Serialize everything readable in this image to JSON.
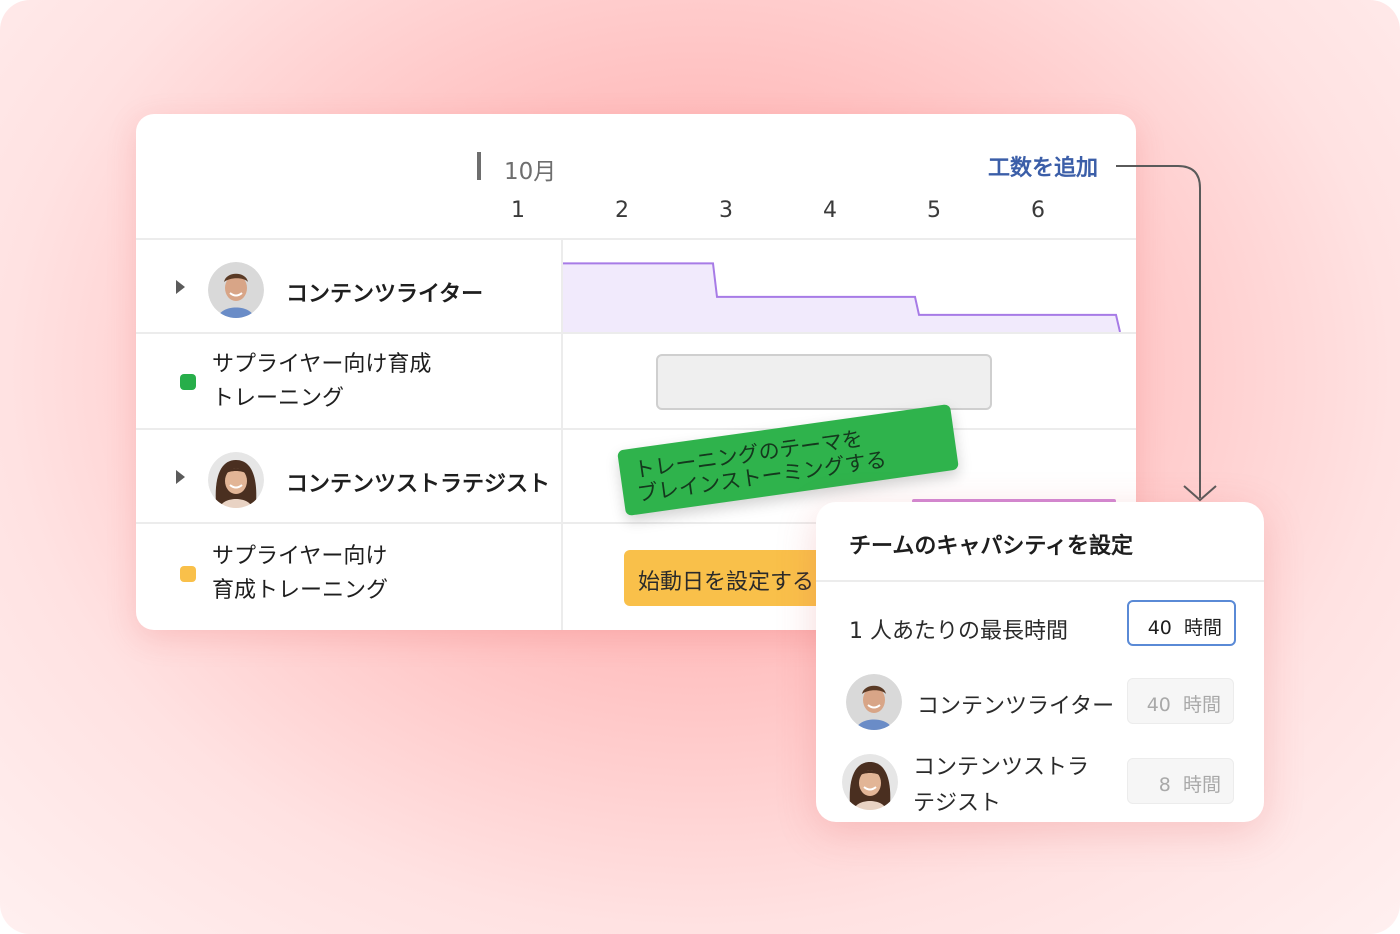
{
  "timeline": {
    "month": "10月",
    "add_effort": "工数を追加",
    "days": [
      "1",
      "2",
      "3",
      "4",
      "5",
      "6"
    ]
  },
  "rows": {
    "writer": {
      "title": "コンテンツライター"
    },
    "task1": {
      "line1": "サプライヤー向け育成",
      "line2": "トレーニング",
      "color": "#27ae4a"
    },
    "strategist": {
      "title": "コンテンツストラテジスト"
    },
    "task2": {
      "line1": "サプライヤー向け",
      "line2": "育成トレーニング",
      "color": "#f9c04a"
    }
  },
  "bars": {
    "drag_card": {
      "line1": "トレーニングのテーマを",
      "line2": "ブレインストーミングする"
    },
    "start_date": "始動日を設定する"
  },
  "capacity": {
    "color_line": "#a77be6",
    "color_fill": "#f1eafc",
    "levels": [
      0.88,
      0.45,
      0.22
    ]
  },
  "popup": {
    "title": "チームのキャパシティを設定",
    "max_label": "1 人あたりの最長時間",
    "max_value": "40",
    "unit": "時間",
    "members": [
      {
        "name": "コンテンツライター",
        "hours": "40"
      },
      {
        "name_line1": "コンテンツストラ",
        "name_line2": "テジスト",
        "hours": "8"
      }
    ]
  },
  "colors": {
    "accent": "#3b5ea8",
    "input_focus": "#5a8ad6",
    "background": "#ffc8c8"
  }
}
